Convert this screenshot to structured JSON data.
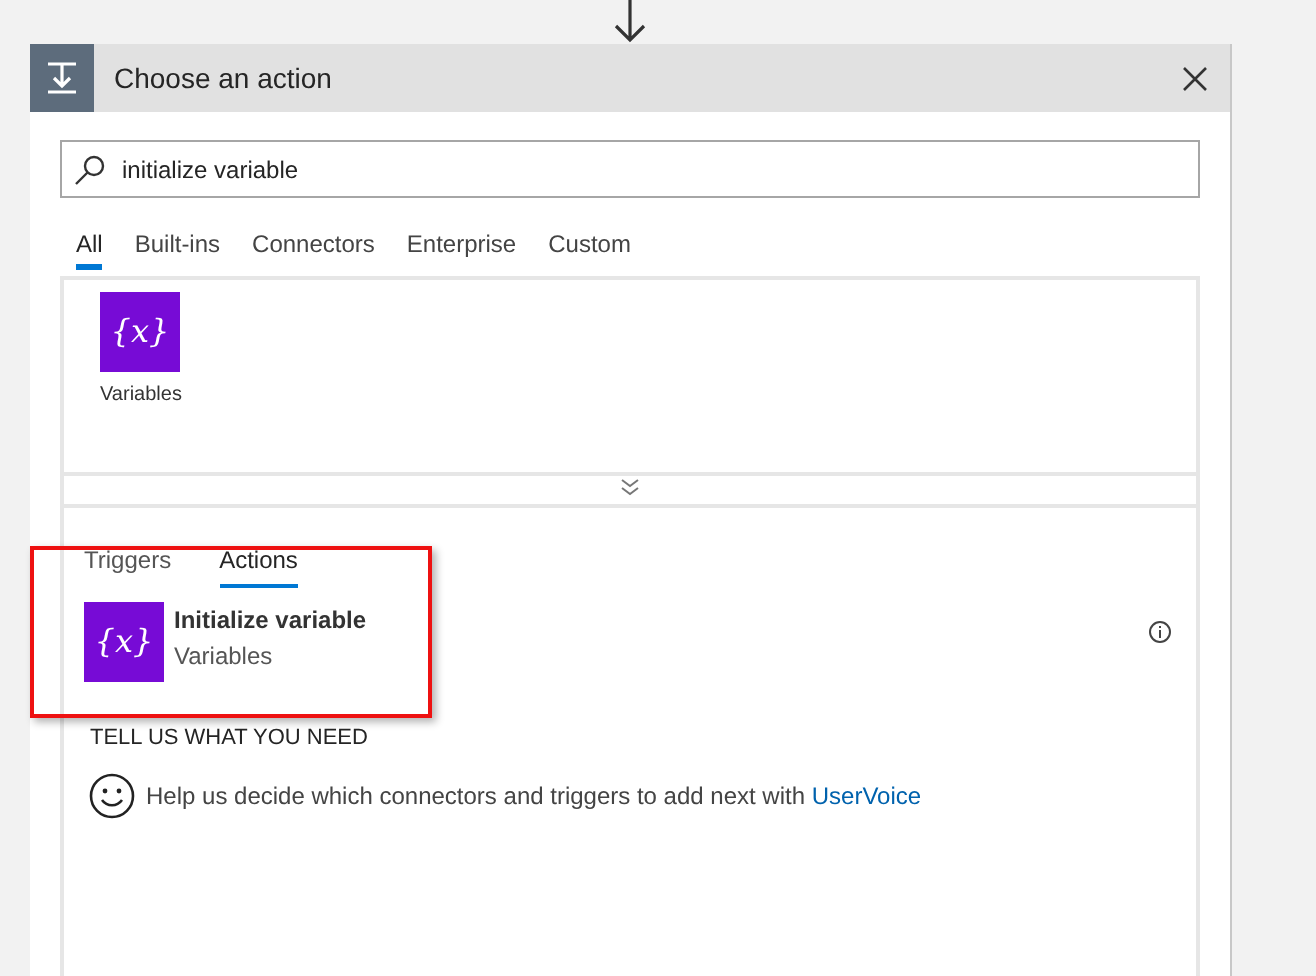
{
  "dialog": {
    "title": "Choose an action"
  },
  "search": {
    "value": "initialize variable"
  },
  "tabs": [
    {
      "label": "All",
      "selected": true
    },
    {
      "label": "Built-ins",
      "selected": false
    },
    {
      "label": "Connectors",
      "selected": false
    },
    {
      "label": "Enterprise",
      "selected": false
    },
    {
      "label": "Custom",
      "selected": false
    }
  ],
  "connectors": [
    {
      "label": "Variables",
      "icon": "{x}"
    }
  ],
  "result_tabs": [
    {
      "label": "Triggers",
      "selected": false
    },
    {
      "label": "Actions",
      "selected": true
    }
  ],
  "results": [
    {
      "title": "Initialize variable",
      "subtitle": "Variables",
      "icon": "{x}"
    }
  ],
  "feedback": {
    "heading": "TELL US WHAT YOU NEED",
    "text": "Help us decide which connectors and triggers to add next with",
    "link": "UserVoice"
  }
}
